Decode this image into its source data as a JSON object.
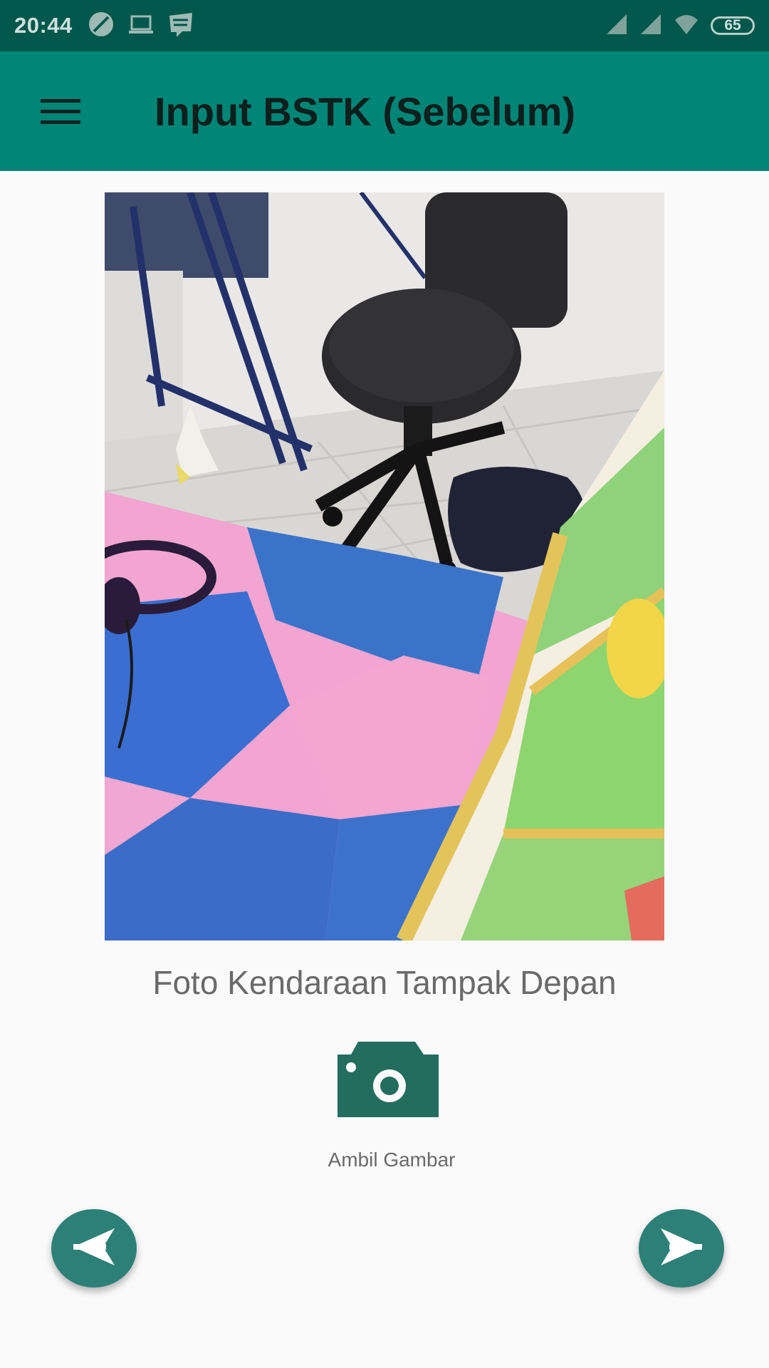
{
  "status_bar": {
    "time": "20:44",
    "left_icons": [
      "leaf-icon",
      "laptop-icon",
      "webtoon-icon"
    ],
    "right_icons": [
      "signal-icon",
      "signal-icon",
      "wifi-icon"
    ],
    "battery": "65"
  },
  "toolbar": {
    "title": "Input BSTK (Sebelum)"
  },
  "photo": {
    "caption": "Foto Kendaraan Tampak Depan"
  },
  "camera": {
    "label": "Ambil Gambar",
    "icon": "camera-icon"
  },
  "navigation": {
    "back_icon": "back-arrow-icon",
    "next_icon": "send-icon"
  },
  "colors": {
    "status_bar": "#00574b",
    "toolbar": "#008577",
    "accent": "#2d8077",
    "camera": "#236d5e"
  }
}
